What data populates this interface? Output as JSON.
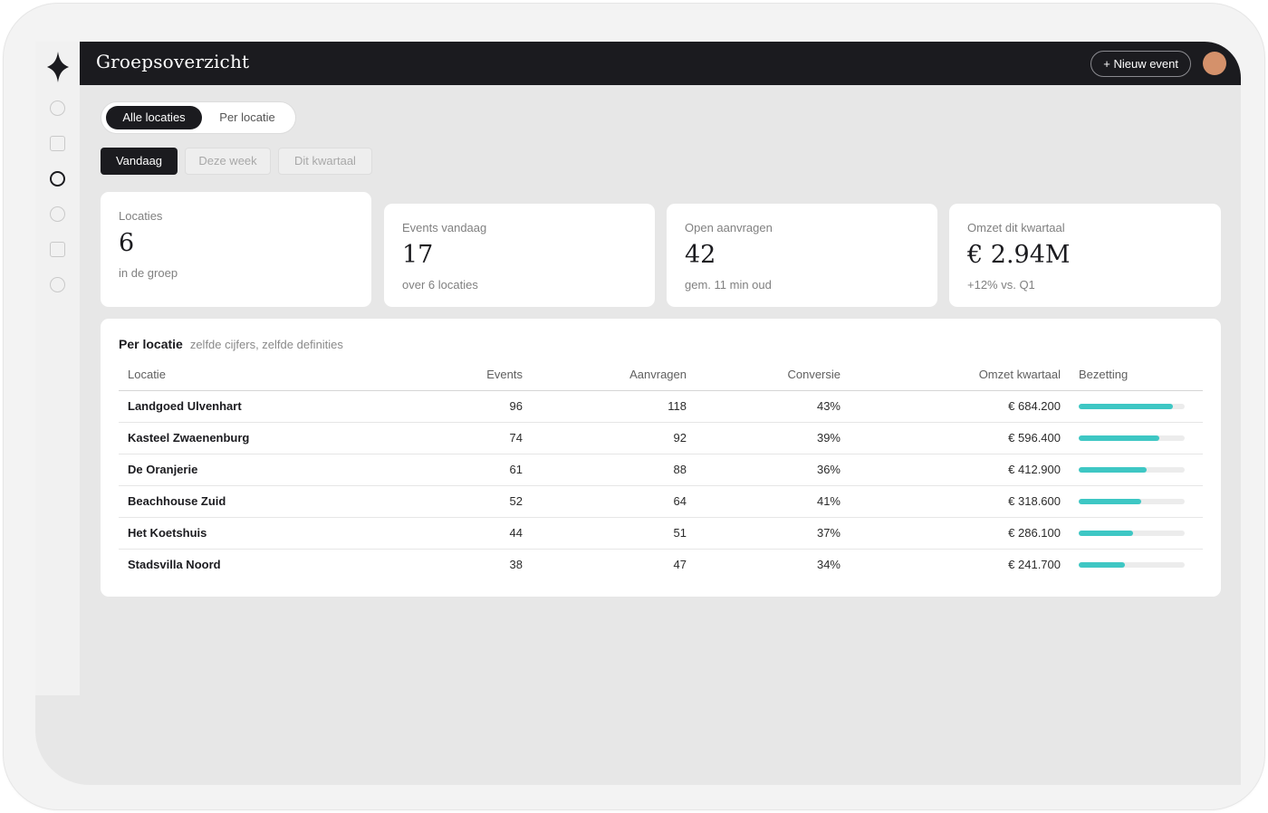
{
  "header": {
    "title": "Groepsoverzicht",
    "new_event_label": "+ Nieuw event"
  },
  "scope_toggle": {
    "options": [
      "Alle locaties",
      "Per locatie"
    ],
    "selected": "Alle locaties"
  },
  "period_tabs": {
    "options": [
      "Vandaag",
      "Deze week",
      "Dit kwartaal"
    ],
    "selected": "Vandaag"
  },
  "kpis": [
    {
      "label": "Locaties",
      "value": "6",
      "sub": "in de groep"
    },
    {
      "label": "Events vandaag",
      "value": "17",
      "sub": "over 6 locaties"
    },
    {
      "label": "Open aanvragen",
      "value": "42",
      "sub": "gem. 11 min oud"
    },
    {
      "label": "Omzet dit kwartaal",
      "value": "€ 2.94M",
      "sub": "+12% vs. Q1"
    }
  ],
  "table": {
    "title": "Per locatie",
    "subtitle": "zelfde cijfers, zelfde definities",
    "columns": [
      "Locatie",
      "Events",
      "Aanvragen",
      "Conversie",
      "Omzet kwartaal",
      "Bezetting"
    ],
    "rows": [
      {
        "locatie": "Landgoed Ulvenhart",
        "events": "96",
        "aanvragen": "118",
        "conversie": "43%",
        "omzet": "€ 684.200",
        "bezetting": 0.89
      },
      {
        "locatie": "Kasteel Zwaenenburg",
        "events": "74",
        "aanvragen": "92",
        "conversie": "39%",
        "omzet": "€ 596.400",
        "bezetting": 0.76
      },
      {
        "locatie": "De Oranjerie",
        "events": "61",
        "aanvragen": "88",
        "conversie": "36%",
        "omzet": "€ 412.900",
        "bezetting": 0.64
      },
      {
        "locatie": "Beachhouse Zuid",
        "events": "52",
        "aanvragen": "64",
        "conversie": "41%",
        "omzet": "€ 318.600",
        "bezetting": 0.59
      },
      {
        "locatie": "Het Koetshuis",
        "events": "44",
        "aanvragen": "51",
        "conversie": "37%",
        "omzet": "€ 286.100",
        "bezetting": 0.51
      },
      {
        "locatie": "Stadsvilla Noord",
        "events": "38",
        "aanvragen": "47",
        "conversie": "34%",
        "omzet": "€ 241.700",
        "bezetting": 0.44
      }
    ]
  },
  "colors": {
    "dark": "#1b1b1f",
    "accent": "#3ec7c4",
    "avatar": "#d4916b"
  }
}
